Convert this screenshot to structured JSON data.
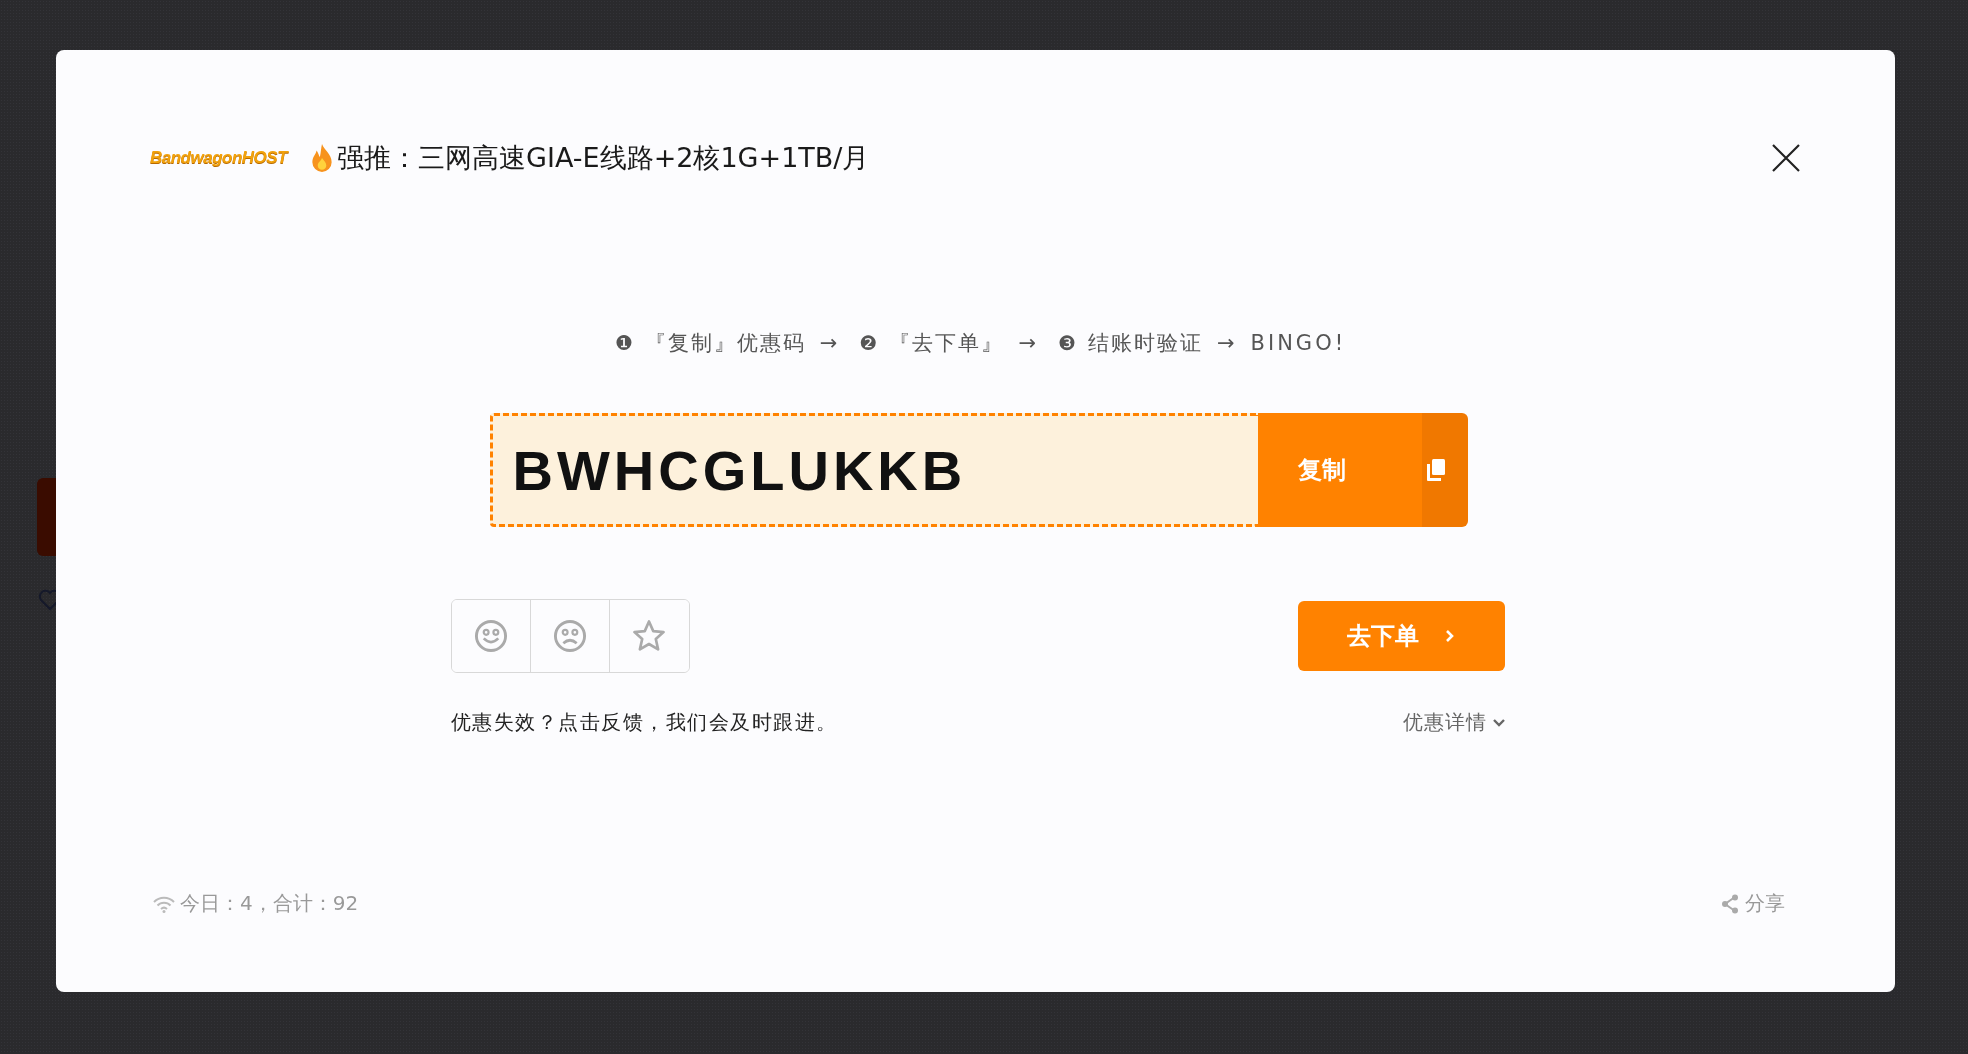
{
  "logo": {
    "text": "BandwagonHOST"
  },
  "title": "强推：三网高速GIA-E线路+2核1G+1TB/月",
  "steps": [
    {
      "marker": "❶",
      "label": "『复制』优惠码",
      "arrow": "→"
    },
    {
      "marker": "❷",
      "label": "『去下单』",
      "arrow": "→"
    },
    {
      "marker": "❸",
      "label": "结账时验证",
      "arrow": "→"
    }
  ],
  "steps_end": "BINGO!",
  "coupon": {
    "code": "BWHCGLUKKB",
    "copy_label": "复制"
  },
  "feedback_buttons": [
    {
      "kind": "happy"
    },
    {
      "kind": "sad"
    },
    {
      "kind": "star"
    }
  ],
  "order_button": "去下单",
  "feedback_note": "优惠失效？点击反馈，我们会及时跟进。",
  "details_link": "优惠详情",
  "stats": "今日：4，合计：92",
  "share": "分享"
}
